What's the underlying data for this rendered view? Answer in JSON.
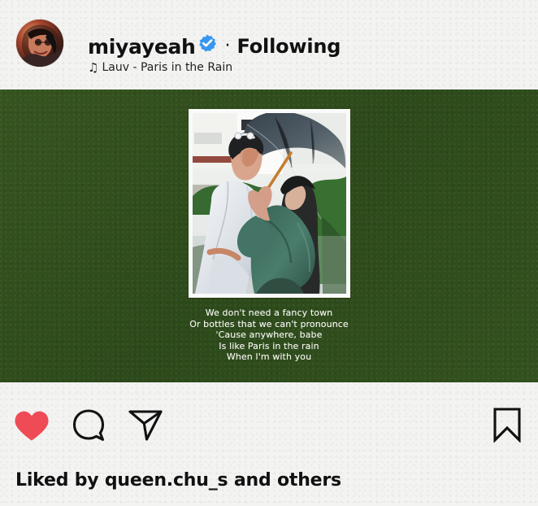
{
  "header": {
    "username": "miyayeah",
    "separator": "·",
    "follow_status": "Following",
    "music_icon": "music-note-icon",
    "music_text": "Lauv - Paris in the Rain"
  },
  "media": {
    "lyrics": [
      "We don't need a fancy town",
      "Or bottles that we can't pronounce",
      "'Cause anywhere, babe",
      "Is like Paris in the rain",
      "When I'm with you"
    ]
  },
  "actions": {
    "like_icon": "heart-icon",
    "comment_icon": "comment-icon",
    "share_icon": "paper-plane-icon",
    "save_icon": "bookmark-icon"
  },
  "likes_text": "Liked by queen.chu_s and others",
  "colors": {
    "background": "#f3f3f2",
    "media_green": "#2f4d1c",
    "like_red": "#ef4b55",
    "verified_blue": "#3897f0"
  }
}
